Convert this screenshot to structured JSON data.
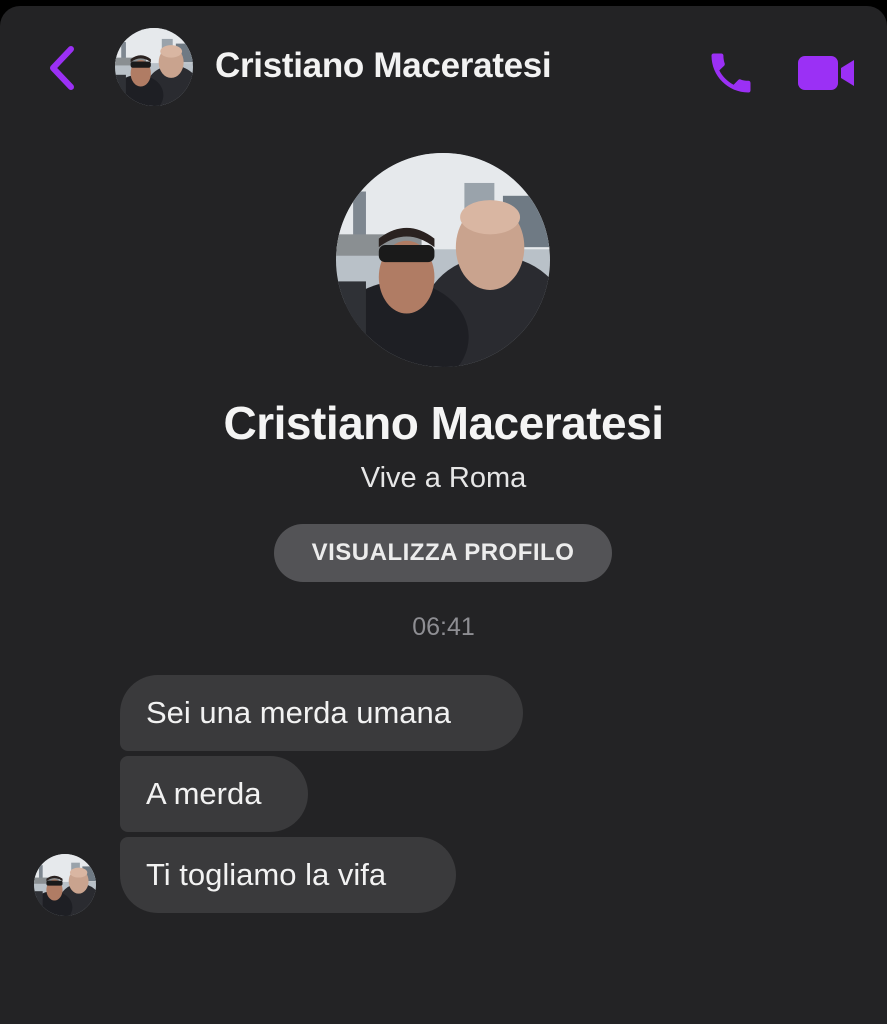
{
  "header": {
    "contact_name": "Cristiano Maceratesi",
    "back_icon": "chevron-left-icon",
    "call_icon": "phone-icon",
    "video_icon": "video-camera-icon",
    "accent_color": "#9b30f5"
  },
  "profile": {
    "name": "Cristiano Maceratesi",
    "location": "Vive a Roma",
    "view_profile_label": "VISUALIZZA PROFILO"
  },
  "conversation": {
    "timestamp": "06:41",
    "messages": [
      {
        "sender": "contact",
        "text": "Sei una merda umana"
      },
      {
        "sender": "contact",
        "text": "A merda"
      },
      {
        "sender": "contact",
        "text": "Ti togliamo la vifa"
      }
    ]
  },
  "colors": {
    "background": "#232325",
    "bubble": "#3a3a3c",
    "button": "#535356",
    "timestamp": "#8e8e93"
  }
}
